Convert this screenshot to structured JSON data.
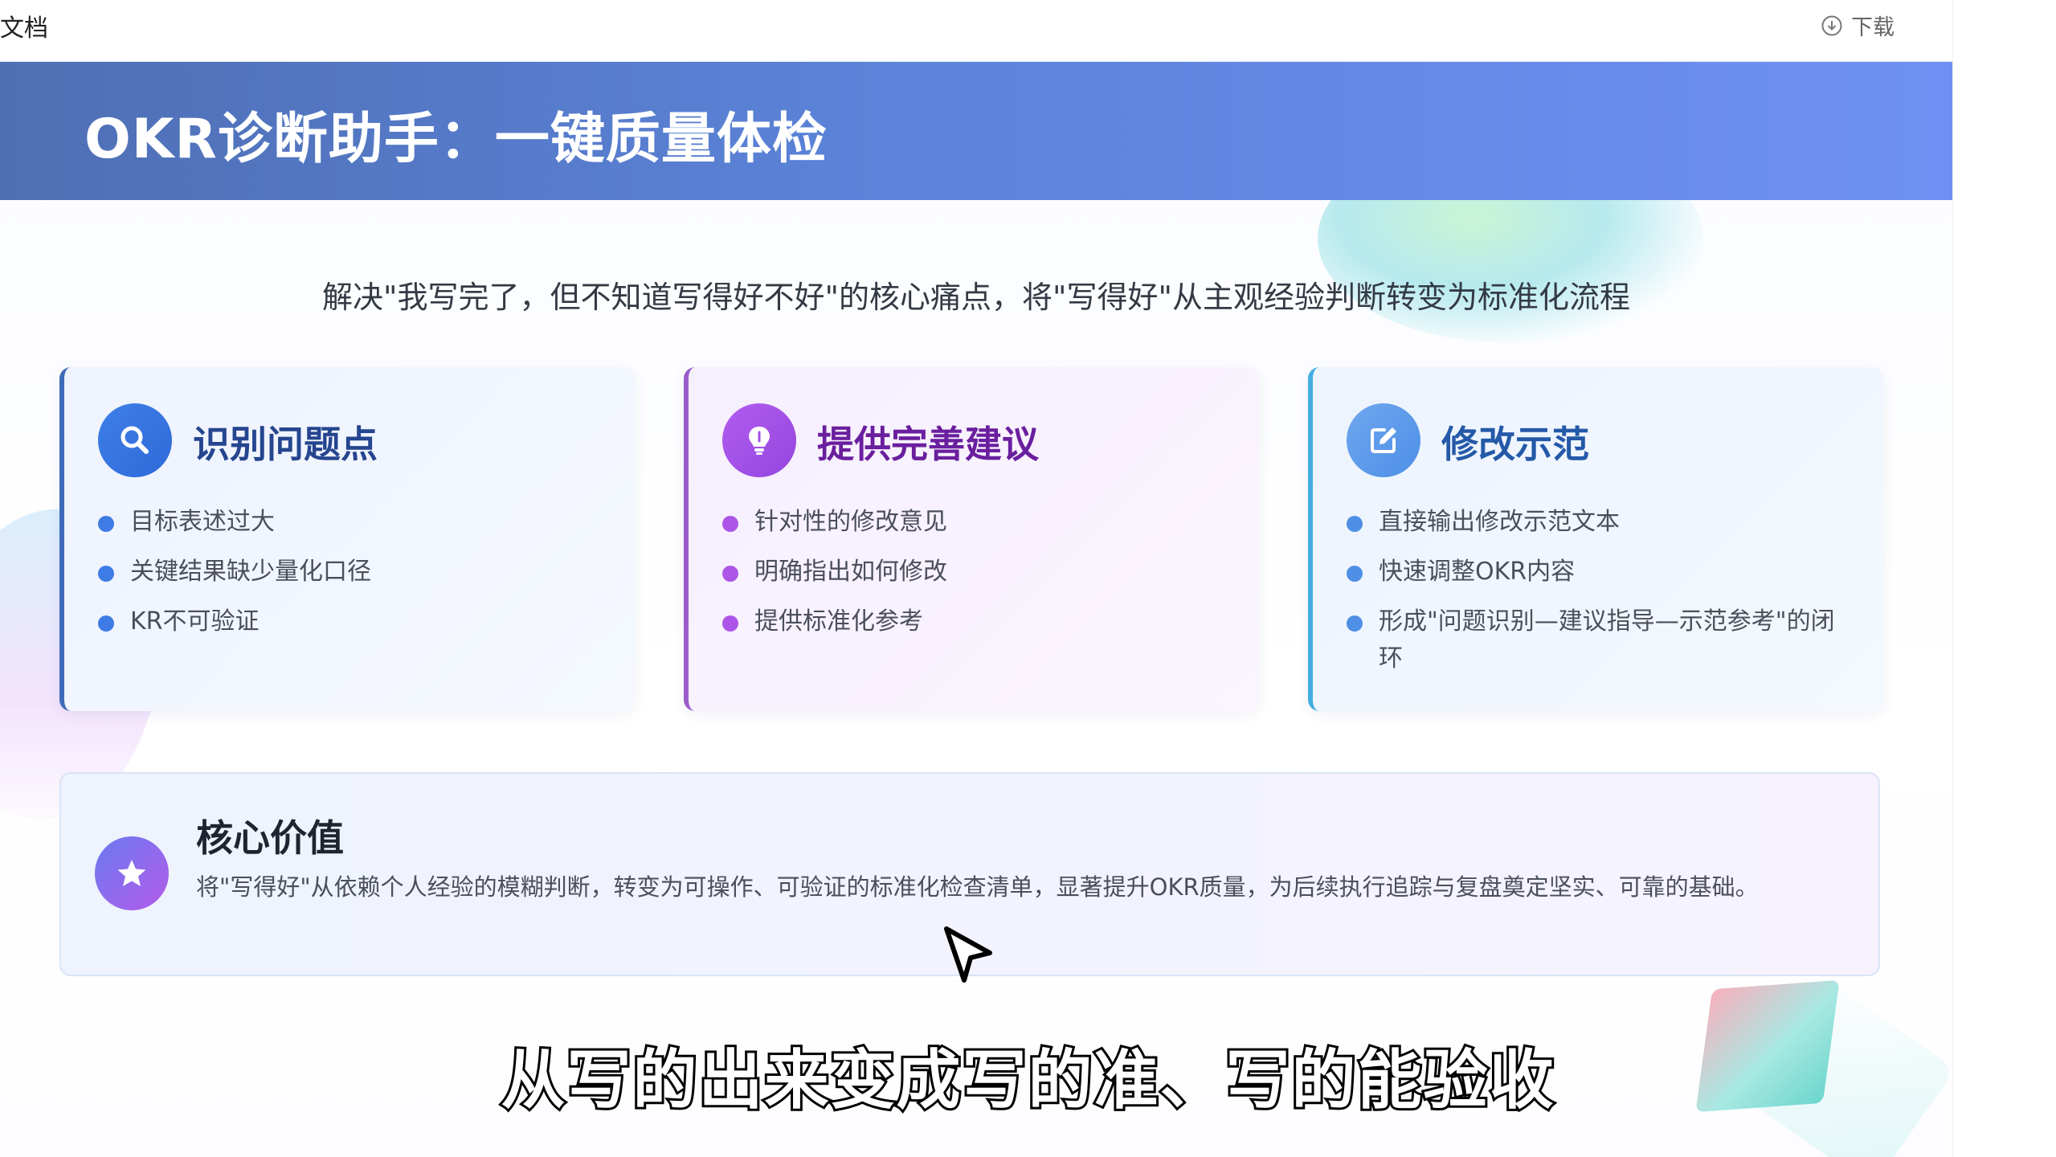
{
  "topbar": {
    "doc_label": "文档",
    "download_label": "下载",
    "download_icon": "download-circle-icon"
  },
  "banner": {
    "title": "OKR诊断助手：一键质量体检"
  },
  "subtitle": "解决\"我写完了，但不知道写得好不好\"的核心痛点，将\"写得好\"从主观经验判断转变为标准化流程",
  "cards": [
    {
      "icon": "search-icon",
      "accent": "#3f6bb8",
      "title": "识别问题点",
      "items": [
        "目标表述过大",
        "关键结果缺少量化口径",
        "KR不可验证"
      ]
    },
    {
      "icon": "lightbulb-icon",
      "accent": "#9b5cc9",
      "title": "提供完善建议",
      "items": [
        "针对性的修改意见",
        "明确指出如何修改",
        "提供标准化参考"
      ]
    },
    {
      "icon": "edit-icon",
      "accent": "#45aee0",
      "title": "修改示范",
      "items": [
        "直接输出修改示范文本",
        "快速调整OKR内容",
        "形成\"问题识别—建议指导—示范参考\"的闭环"
      ]
    }
  ],
  "core_value": {
    "icon": "star-icon",
    "title": "核心价值",
    "text": "将\"写得好\"从依赖个人经验的模糊判断，转变为可操作、可验证的标准化检查清单，显著提升OKR质量，为后续执行追踪与复盘奠定坚实、可靠的基础。"
  },
  "caption": "从写的出来变成写的准、写的能验收",
  "colors": {
    "banner_start": "#4f6fb4",
    "banner_end": "#6e90f4"
  }
}
